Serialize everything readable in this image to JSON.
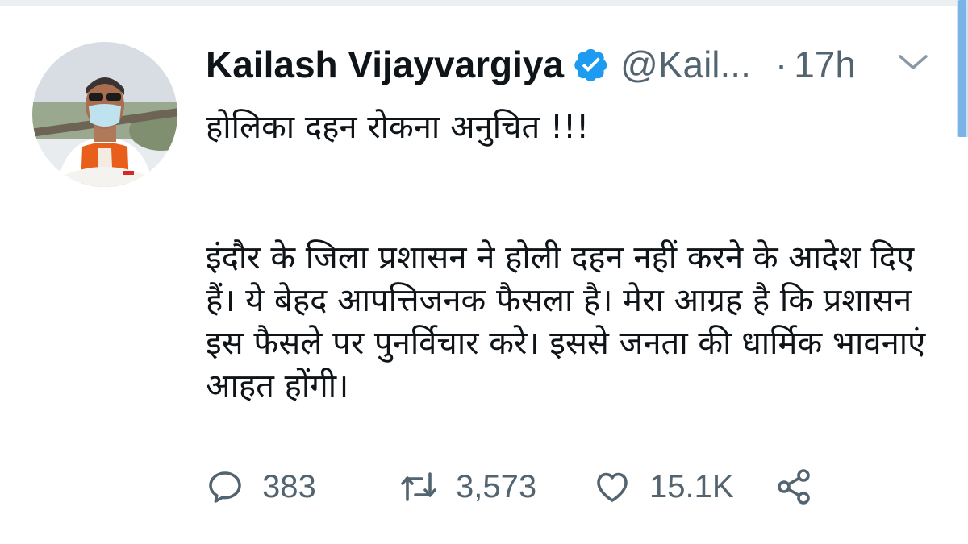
{
  "tweet": {
    "author_name": "Kailash Vijayvargiya",
    "handle": "@Kail...",
    "separator": "·",
    "time": "17h",
    "text_line_1": "होलिका दहन रोकना अनुचित !!!",
    "text_paragraph_2": "इंदौर के जिला प्रशासन ने होली दहन नहीं करने के आदेश दिए हैं। ये बेहद आपत्तिजनक फैसला है। मेरा आग्रह है कि प्रशासन इस फैसले पर पुनर्विचार करे। इससे जनता की धार्मिक भावनाएं आहत होंगी।"
  },
  "actions": {
    "reply_count": "383",
    "retweet_count": "3,573",
    "like_count": "15.1K"
  },
  "icons": {
    "verified": "verified-badge-icon",
    "more": "chevron-down-icon",
    "reply": "reply-icon",
    "retweet": "retweet-icon",
    "like": "heart-icon",
    "share": "share-icon"
  },
  "colors": {
    "primary_text": "#0f1419",
    "secondary_text": "#536471",
    "verified_blue": "#1d9bf0"
  }
}
